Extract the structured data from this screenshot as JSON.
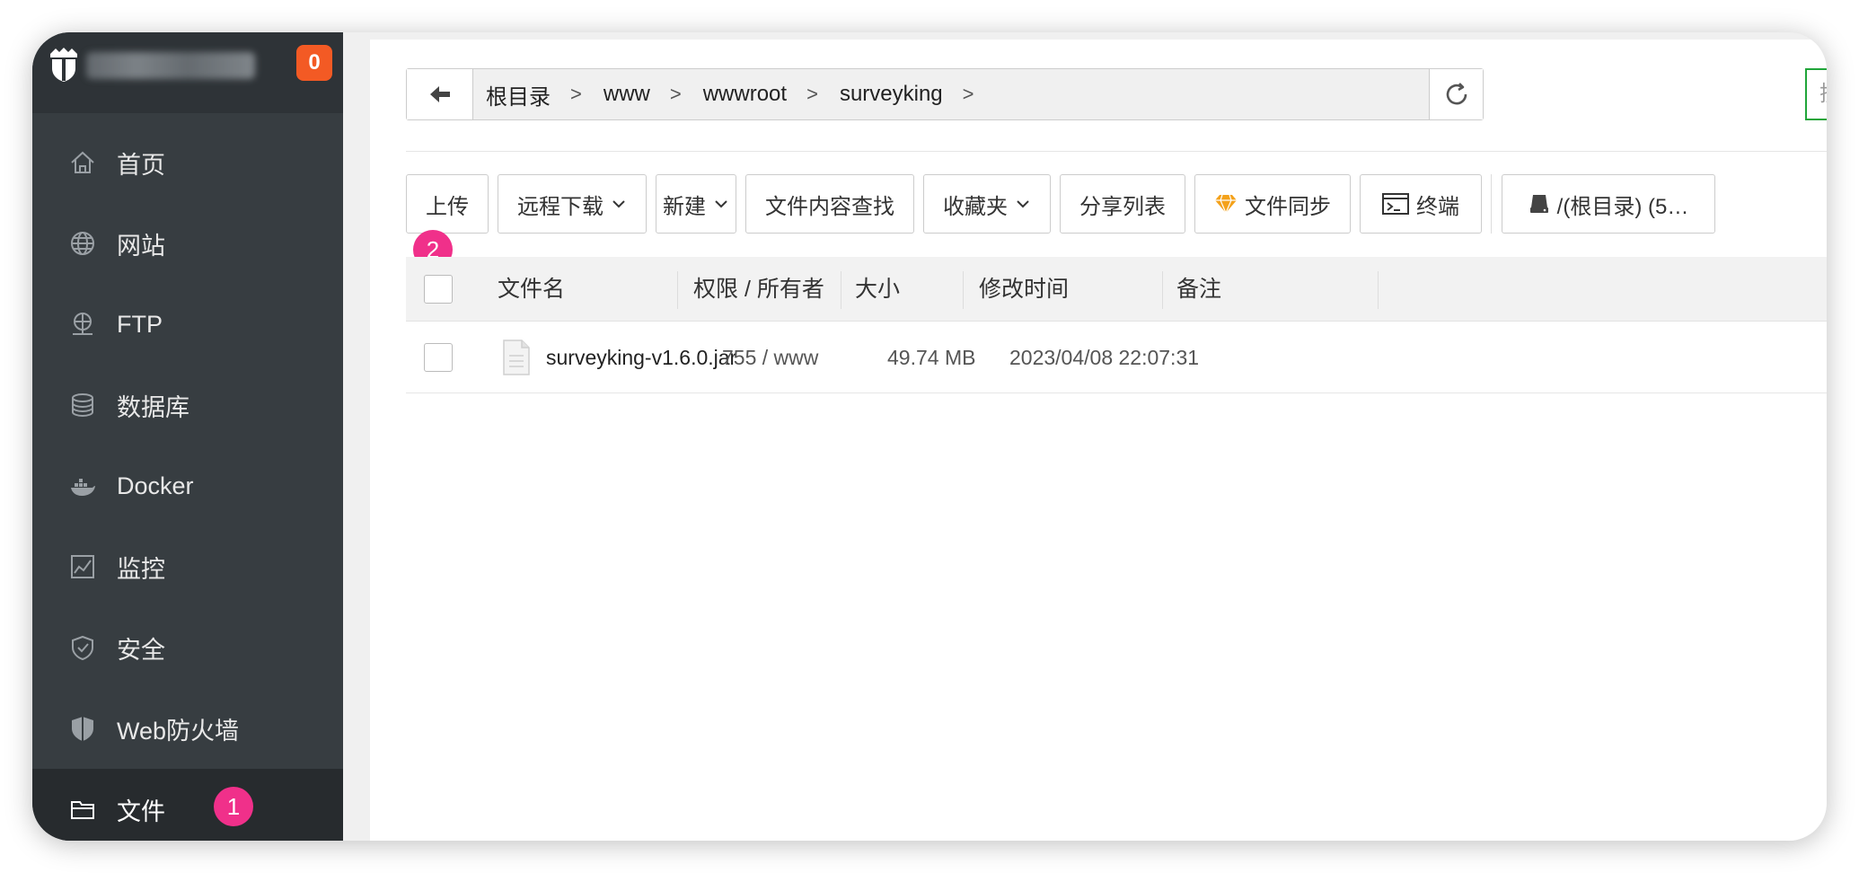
{
  "sidebar": {
    "message_count": "0",
    "items": [
      {
        "label": "首页",
        "icon": "home-icon"
      },
      {
        "label": "网站",
        "icon": "globe-icon"
      },
      {
        "label": "FTP",
        "icon": "ftp-icon"
      },
      {
        "label": "数据库",
        "icon": "database-icon"
      },
      {
        "label": "Docker",
        "icon": "docker-icon"
      },
      {
        "label": "监控",
        "icon": "monitor-icon"
      },
      {
        "label": "安全",
        "icon": "shield-icon"
      },
      {
        "label": "Web防火墙",
        "icon": "firewall-icon"
      },
      {
        "label": "文件",
        "icon": "folder-icon",
        "active": true
      }
    ]
  },
  "callouts": {
    "one": "1",
    "two": "2"
  },
  "pathbar": {
    "crumbs": [
      "根目录",
      "www",
      "wwwroot",
      "surveyking"
    ],
    "separator": ">"
  },
  "search": {
    "placeholder": "搜索"
  },
  "toolbar": {
    "upload": "上传",
    "remote_download": "远程下载",
    "new": "新建",
    "content_search": "文件内容查找",
    "favorites": "收藏夹",
    "share_list": "分享列表",
    "file_sync": "文件同步",
    "terminal": "终端",
    "disk": "/(根目录) (5…"
  },
  "table": {
    "columns": [
      "文件名",
      "权限 / 所有者",
      "大小",
      "修改时间",
      "备注"
    ],
    "rows": [
      {
        "name": "surveyking-v1.6.0.jar",
        "perm": "755 / www",
        "size": "49.74 MB",
        "mtime": "2023/04/08 22:07:31",
        "note": ""
      }
    ]
  },
  "colors": {
    "accent": "#20a53a",
    "badge": "#f35a24",
    "callout": "#f0308a",
    "sidebar": "#373d41"
  }
}
